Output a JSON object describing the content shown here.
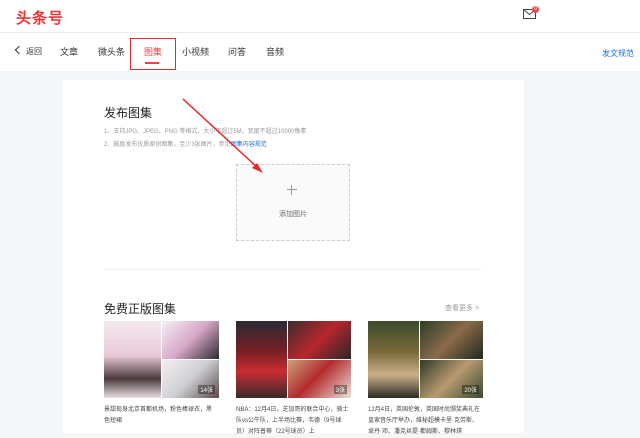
{
  "header": {
    "logo": "头条号",
    "mail_badge": "0"
  },
  "nav": {
    "back": "返回",
    "tabs": [
      "文章",
      "微头条",
      "图集",
      "小视频",
      "问答",
      "音频"
    ],
    "active_tab": "图集",
    "rules_link": "发文规范"
  },
  "publish": {
    "title": "发布图集",
    "tip1_main": "1、支持JPG、JPEG、PNG 等格式，大小不超过5M，宽度不超过10000像素",
    "tip2_main": "2、鼓励发布优质原创图集，至少3张图片，参见",
    "tip2_link": "图集内容规范",
    "upload_label": "添加图片"
  },
  "free": {
    "title": "免费正版图集",
    "more": "查看更多 >",
    "albums": [
      {
        "count": "14张",
        "caption": "景甜现身北京首都机场，粉色棒球衣，黑色短裙"
      },
      {
        "count": "3张",
        "caption": "NBA：12月4日，芝加哥的联合中心，骑士队vs公牛队，上半场比赛，韦德（9号球员）对阵普蒂（22号球员）上"
      },
      {
        "count": "20张",
        "caption": "12月4日，英国伦敦，英国时尚颁奖典礼在皇家音乐厅举办，维秘超模卡里·克劳斯、卓丹·邓、潘克丝提·都姆斯、穆林琪"
      }
    ]
  },
  "colors": {
    "brand_red": "#f04142",
    "link_blue": "#1a6fd6",
    "annotation_red": "#e32b2b"
  }
}
